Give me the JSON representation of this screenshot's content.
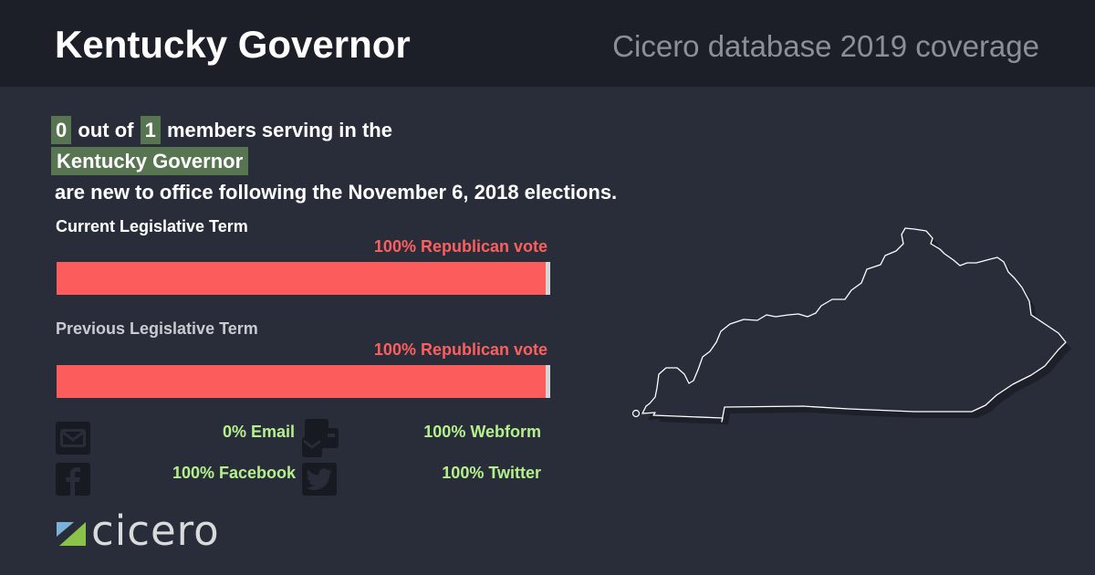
{
  "header": {
    "title": "Kentucky Governor",
    "subtitle": "Cicero database 2019 coverage"
  },
  "summary": {
    "new_count": "0",
    "out_of_text": "out of",
    "total": "1",
    "members_text": "members serving in the",
    "body_name": "Kentucky Governor",
    "tail_text": "are new to office following the November 6, 2018 elections."
  },
  "terms": [
    {
      "label": "Current Legislative Term",
      "vote_text": "100% Republican vote",
      "republican_share": 0.99
    },
    {
      "label": "Previous Legislative Term",
      "vote_text": "100% Republican vote",
      "republican_share": 0.99
    }
  ],
  "contact": {
    "email": {
      "label": "0% Email",
      "icon": "email-icon"
    },
    "webform": {
      "label": "100% Webform",
      "icon": "webform-icon"
    },
    "facebook": {
      "label": "100% Facebook",
      "icon": "facebook-icon"
    },
    "twitter": {
      "label": "100% Twitter",
      "icon": "twitter-icon"
    }
  },
  "logo": {
    "text": "cicero"
  },
  "colors": {
    "background": "#292d3a",
    "header_background": "#1c1f27",
    "highlight": "#587552",
    "republican": "#fd5c5c",
    "contact_text": "#b5f08d"
  }
}
